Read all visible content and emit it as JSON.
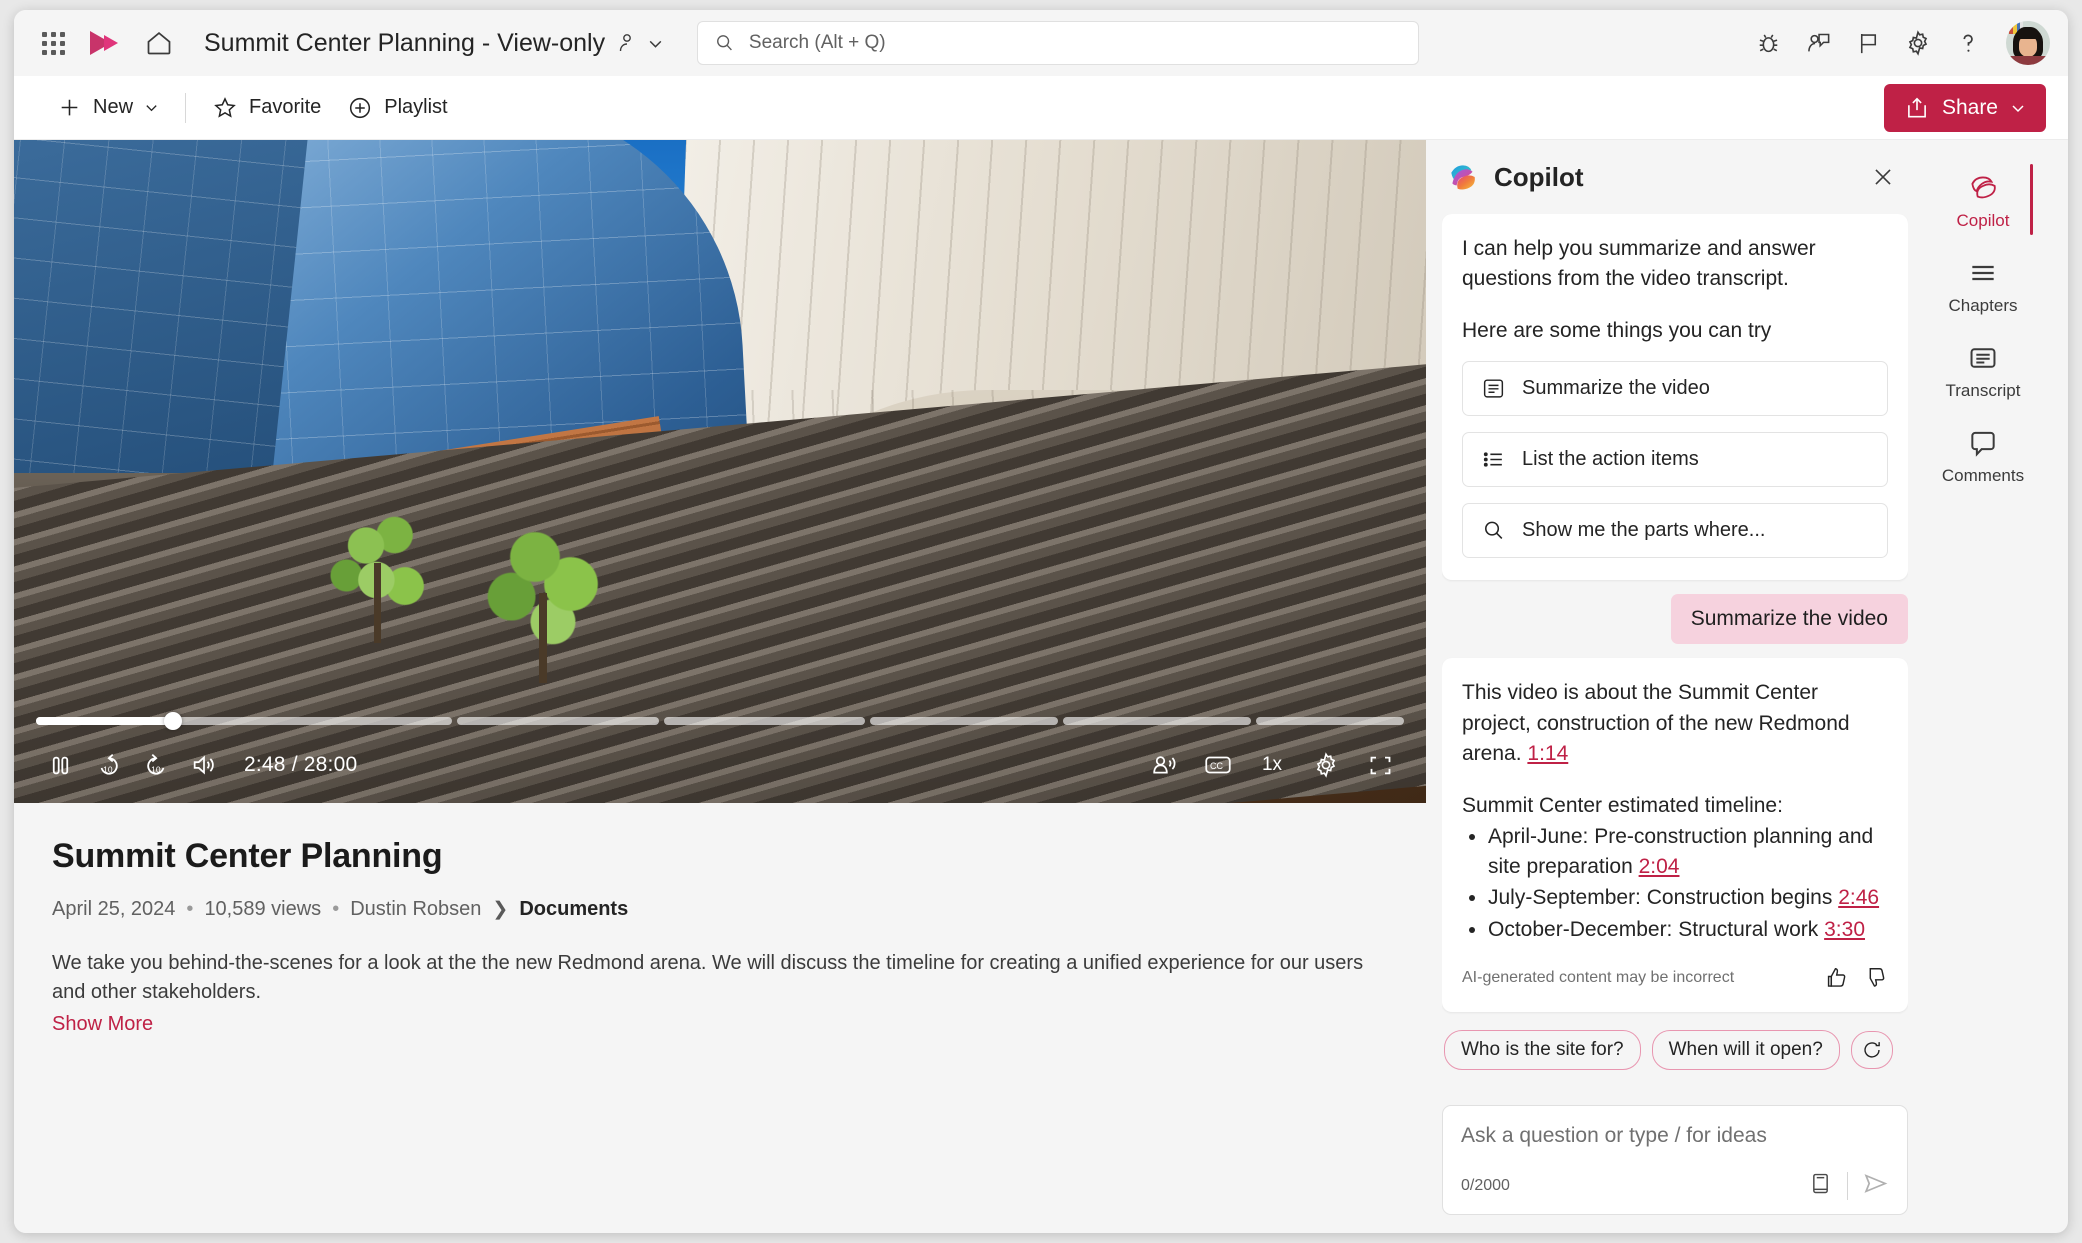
{
  "header": {
    "title": "Summit Center Planning - View-only",
    "icons": {
      "waffle": "app-launcher-icon",
      "brand": "stream-logo-icon",
      "home": "home-icon",
      "people": "people-view-only-icon",
      "chevron": "chevron-down-icon",
      "bug": "bug-icon",
      "feedback": "person-feedback-icon",
      "flag": "flag-icon",
      "settings": "gear-icon",
      "help": "help-question-icon",
      "avatar": "user-avatar"
    }
  },
  "search": {
    "placeholder": "Search (Alt + Q)",
    "value": ""
  },
  "commandbar": {
    "new_label": "New",
    "favorite_label": "Favorite",
    "playlist_label": "Playlist",
    "share_label": "Share"
  },
  "player": {
    "current_time": "2:48",
    "total_time": "28:00",
    "time_display": "2:48 / 28:00",
    "speed": "1x",
    "progress_percent": 10,
    "chapter_segments": [
      31,
      15,
      15,
      14,
      14,
      11
    ],
    "controls": {
      "pause": "pause-icon",
      "rewind": "rewind-10-icon",
      "forward": "forward-10-icon",
      "volume": "volume-icon",
      "noise_suppression": "speaker-person-icon",
      "captions": "closed-captions-icon",
      "settings": "gear-icon",
      "fullscreen": "fullscreen-icon"
    }
  },
  "video_meta": {
    "title": "Summit Center Planning",
    "date": "April 25, 2024",
    "views": "10,589 views",
    "author": "Dustin Robsen",
    "location": "Documents",
    "description": "We take you behind-the-scenes for a look at the the new Redmond arena. We will discuss the timeline for creating a unified experience for our users and other stakeholders.",
    "show_more": "Show More"
  },
  "copilot": {
    "title": "Copilot",
    "intro_line1": "I can help you summarize and answer questions from the video transcript.",
    "intro_line2": "Here are some things you can try",
    "suggestions": [
      {
        "label": "Summarize the video",
        "icon": "summary-document-icon"
      },
      {
        "label": "List the action items",
        "icon": "bulleted-list-icon"
      },
      {
        "label": "Show me the parts where...",
        "icon": "search-icon"
      }
    ],
    "user_message": "Summarize the video",
    "answer": {
      "intro": "This video is about the Summit Center project, construction of the new Redmond arena.",
      "intro_timestamp": "1:14",
      "timeline_heading": "Summit Center estimated timeline:",
      "timeline": [
        {
          "text": "April-June: Pre-construction planning and site preparation",
          "timestamp": "2:04"
        },
        {
          "text": "July-September: Construction begins",
          "timestamp": "2:46"
        },
        {
          "text": "October-December: Structural work",
          "timestamp": "3:30"
        }
      ],
      "disclaimer": "AI-generated content may be incorrect",
      "thumbs_up": "thumbs-up-icon",
      "thumbs_down": "thumbs-down-icon"
    },
    "chips": [
      "Who is the site for?",
      "When will it open?"
    ],
    "refresh_icon": "refresh-icon",
    "composer": {
      "placeholder": "Ask a question or type / for ideas",
      "value": "",
      "counter": "0/2000",
      "prompt_icon": "prompt-book-icon",
      "send_icon": "send-icon"
    }
  },
  "rail": {
    "items": [
      {
        "label": "Copilot",
        "icon": "copilot-icon",
        "active": true
      },
      {
        "label": "Chapters",
        "icon": "chapters-icon",
        "active": false
      },
      {
        "label": "Transcript",
        "icon": "transcript-icon",
        "active": false
      },
      {
        "label": "Comments",
        "icon": "comments-icon",
        "active": false
      }
    ]
  },
  "colors": {
    "accent": "#bf2146",
    "user_bubble": "#f6d2de",
    "chip_border": "#e896b0"
  }
}
